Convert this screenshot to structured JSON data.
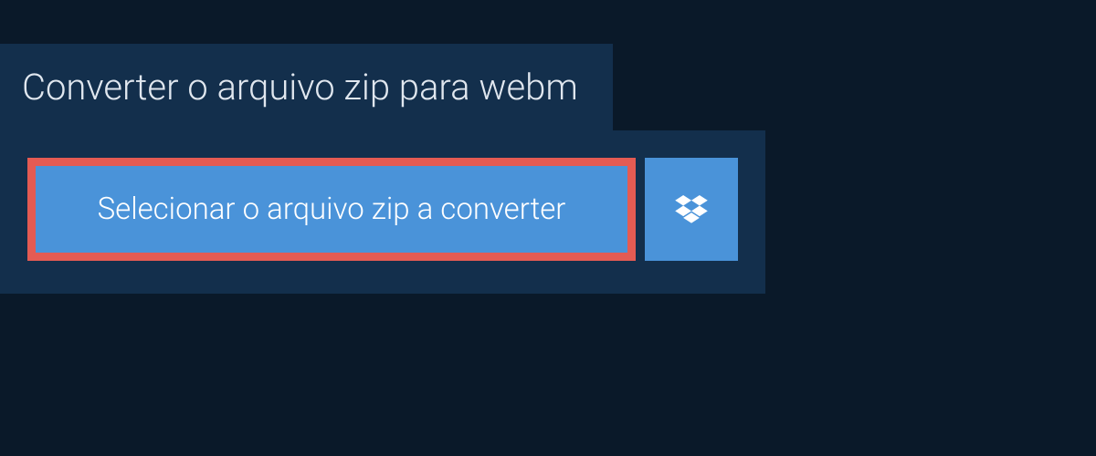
{
  "header": {
    "title": "Converter o arquivo zip para webm"
  },
  "actions": {
    "select_file_label": "Selecionar o arquivo zip a converter"
  },
  "icons": {
    "dropbox": "dropbox-icon"
  }
}
